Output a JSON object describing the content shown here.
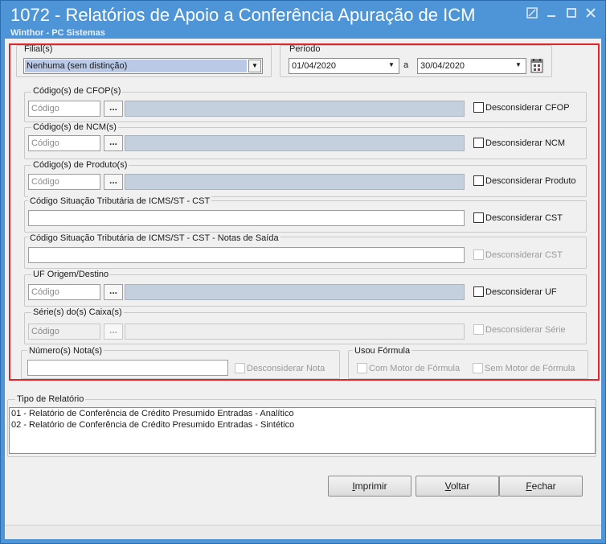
{
  "window": {
    "title": "1072 - Relatórios de Apoio a Conferência Apuração de ICM",
    "subtitle": "Winthor - PC Sistemas",
    "controls": [
      "pin-icon",
      "minimize-icon",
      "maximize-icon",
      "close-icon"
    ]
  },
  "filial": {
    "label": "Filial(s)",
    "selected": "Nenhuma (sem distinção)"
  },
  "periodo": {
    "label": "Período",
    "from": "01/04/2020",
    "to_label": "a",
    "to": "30/04/2020"
  },
  "sections": {
    "cfop": {
      "label": "Código(s) de CFOP(s)",
      "placeholder": "Código",
      "button": "...",
      "checkbox": "Desconsiderar CFOP"
    },
    "ncm": {
      "label": "Código(s) de NCM(s)",
      "placeholder": "Código",
      "button": "...",
      "checkbox": "Desconsiderar NCM"
    },
    "produto": {
      "label": "Código(s) de Produto(s)",
      "placeholder": "Código",
      "button": "...",
      "checkbox": "Desconsiderar Produto"
    },
    "cst": {
      "label": "Código Situação Tributária de ICMS/ST - CST",
      "checkbox": "Desconsiderar CST"
    },
    "cst_saida": {
      "label": "Código Situação Tributária de ICMS/ST - CST -  Notas de Saída",
      "checkbox": "Desconsiderar CST"
    },
    "uf": {
      "label": "UF Origem/Destino",
      "placeholder": "Código",
      "button": "...",
      "checkbox": "Desconsiderar UF"
    },
    "serie": {
      "label": "Série(s) do(s) Caixa(s)",
      "value": "Código",
      "button": "...",
      "checkbox": "Desconsiderar Série"
    },
    "nota": {
      "label": "Número(s) Nota(s)",
      "checkbox": "Desconsiderar Nota"
    },
    "formula": {
      "label": "Usou Fórmula",
      "option1": "Com Motor de Fórmula",
      "option2": "Sem Motor de Fórmula"
    }
  },
  "tipo_relatorio": {
    "label": "Tipo de Relatório",
    "items": [
      "01 - Relatório de Conferência de Crédito Presumido Entradas - Analítico",
      "02 - Relatório de Conferência de Crédito Presumido Entradas - Sintético"
    ]
  },
  "buttons": {
    "imprimir": {
      "first": "I",
      "rest": "mprimir"
    },
    "voltar": {
      "first": "V",
      "rest": "oltar"
    },
    "fechar": {
      "first": "F",
      "rest": "echar"
    }
  },
  "colors": {
    "titlebar": "#4e95d8",
    "highlight": "#e0262b",
    "description_field": "#c4d0dd",
    "filial_selection": "#b9c9e6"
  }
}
